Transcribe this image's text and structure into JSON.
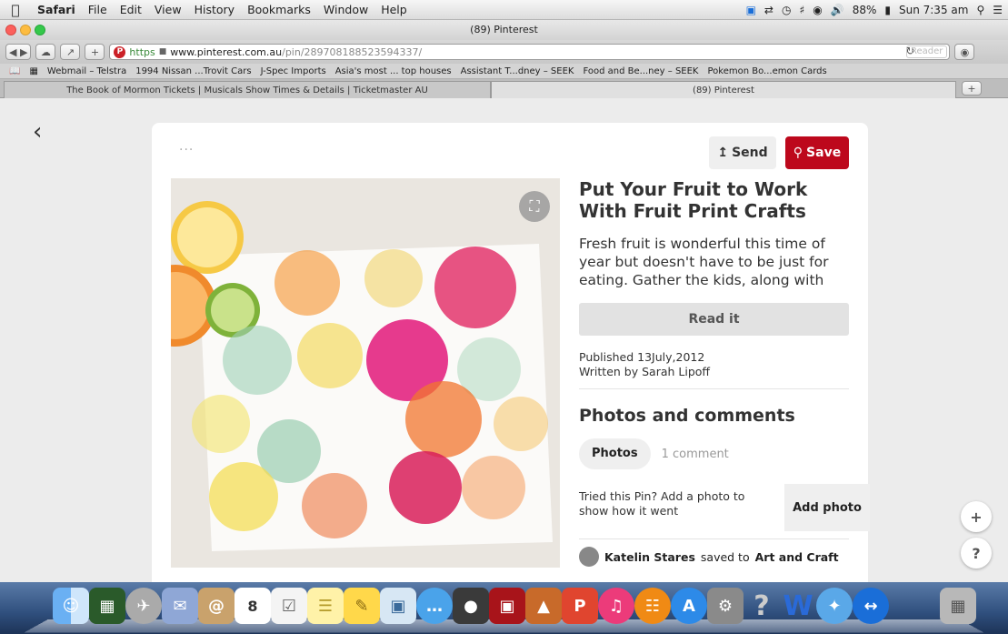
{
  "menubar": {
    "app": "Safari",
    "items": [
      "File",
      "Edit",
      "View",
      "History",
      "Bookmarks",
      "Window",
      "Help"
    ],
    "battery": "88%",
    "clock": "Sun 7:35 am"
  },
  "window": {
    "title": "(89) Pinterest"
  },
  "toolbar": {
    "scheme": "https",
    "domain": "www.pinterest.com.au",
    "path": "/pin/289708188523594337/",
    "reader": "Reader",
    "pin_favicon": "P"
  },
  "bookmarks": [
    "Webmail – Telstra",
    "1994 Nissan ...Trovit Cars",
    "J-Spec Imports",
    "Asia's most ... top houses",
    "Assistant T...dney – SEEK",
    "Food and Be...ney – SEEK",
    "Pokemon Bo...emon Cards"
  ],
  "tabs": [
    {
      "label": "The Book of Mormon Tickets | Musicals Show Times & Details | Ticketmaster AU"
    },
    {
      "label": "(89) Pinterest"
    }
  ],
  "pin": {
    "send_label": "Send",
    "save_label": "Save",
    "title": "Put Your Fruit to Work With Fruit Print Crafts",
    "description": "Fresh fruit is wonderful this time of year but doesn't have to be just for eating. Gather the kids, along with their favorite fruits, and enjoy a fun and easy",
    "read_it": "Read it",
    "published": "Published 13July,2012",
    "author": "Written by Sarah Lipoff",
    "section_heading": "Photos and comments",
    "tab_photos": "Photos",
    "tab_comments": "1 comment",
    "tried_text": "Tried this Pin? Add a photo to show how it went",
    "add_photo": "Add photo",
    "comment_user": "Katelin Stares",
    "comment_mid": "saved to",
    "comment_board": "Art and Craft"
  },
  "floating": {
    "plus": "+",
    "help": "?"
  },
  "dock": {
    "calendar_day": "8"
  },
  "colors": {
    "pinterest_red": "#bd081c",
    "button_gray": "#efefef"
  }
}
